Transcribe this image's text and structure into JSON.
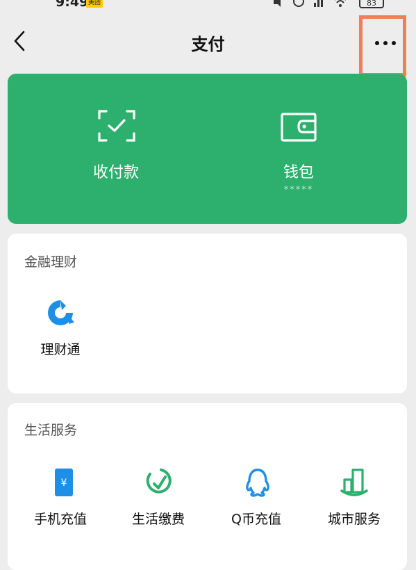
{
  "status": {
    "time": "9:49",
    "badge": "美团",
    "battery": "83"
  },
  "nav": {
    "title": "支付"
  },
  "green_card": {
    "items": [
      {
        "label": "收付款",
        "icon": "scan-pay-icon"
      },
      {
        "label": "钱包",
        "sub": "*****",
        "icon": "wallet-icon"
      }
    ]
  },
  "finance": {
    "title": "金融理财",
    "items": [
      {
        "label": "理财通",
        "icon": "licaitong-icon"
      }
    ]
  },
  "life": {
    "title": "生活服务",
    "items": [
      {
        "label": "手机充值",
        "icon": "phone-recharge-icon"
      },
      {
        "label": "生活缴费",
        "icon": "utility-payment-icon"
      },
      {
        "label": "Q币充值",
        "icon": "qq-coin-icon"
      },
      {
        "label": "城市服务",
        "icon": "city-service-icon"
      }
    ]
  },
  "colors": {
    "green": "#2daf6d",
    "icon_blue": "#1f8fe5",
    "highlight": "#f07f54"
  }
}
